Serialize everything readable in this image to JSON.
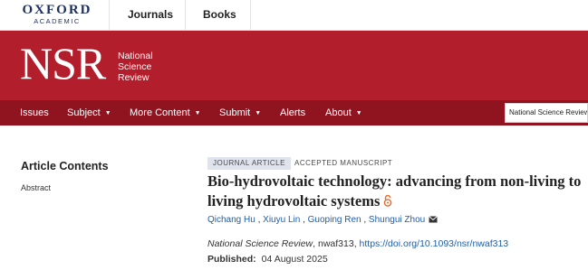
{
  "topbar": {
    "logo_main": "OXFORD",
    "logo_sub": "ACADEMIC",
    "links": [
      "Journals",
      "Books"
    ]
  },
  "banner": {
    "logo": "NSR",
    "subtitle": [
      "National",
      "Science",
      "Review"
    ],
    "color": "#b21e2b"
  },
  "nav": {
    "color": "#8f1420",
    "items": [
      "Issues",
      "Subject",
      "More Content",
      "Submit",
      "Alerts",
      "About"
    ],
    "search_value": "National Science Review"
  },
  "sidebar": {
    "title": "Article Contents",
    "links": [
      "Abstract"
    ]
  },
  "article": {
    "type_tag": "JOURNAL ARTICLE",
    "status_tag": "ACCEPTED MANUSCRIPT",
    "title": "Bio-hydrovoltaic technology: advancing from non-living to living hydrovoltaic systems",
    "authors": [
      "Qichang Hu",
      "Xiuyu Lin",
      "Guoping Ren",
      "Shungui Zhou"
    ],
    "journal": "National Science Review",
    "article_id": ", nwaf313, ",
    "doi": "https://doi.org/10.1093/nsr/nwaf313",
    "published_label": "Published:",
    "published_date": "04 August 2025",
    "open_access_icon": "open-access-lock-icon",
    "email_icon": "envelope-icon"
  }
}
